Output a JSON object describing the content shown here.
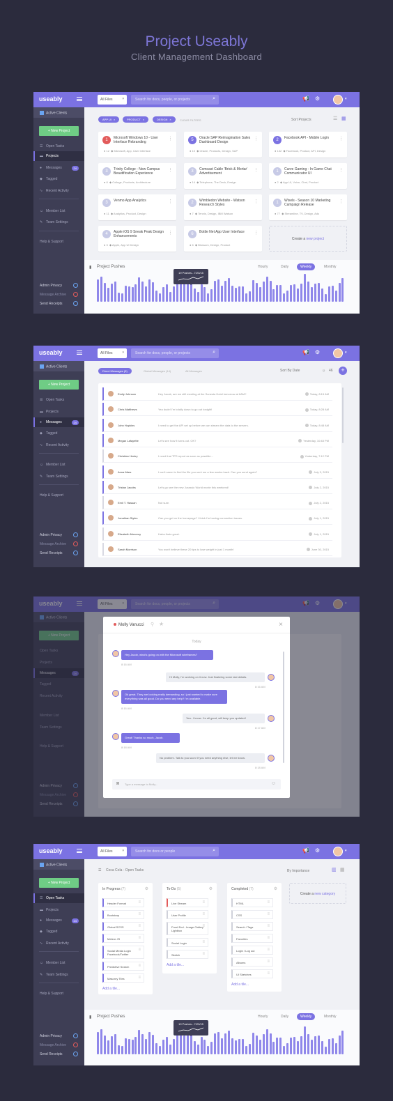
{
  "hero": {
    "title": "Project Useably",
    "subtitle": "Client Management Dashboard"
  },
  "common": {
    "logo": "useably",
    "file_select": "All Files",
    "search_placeholder": "Search for docs, people, or projects",
    "search_placeholder_short": "Search for docs or people",
    "active_clients": "Active Clients",
    "new_project": "+ New Project",
    "nav": {
      "open_tasks": "Open Tasks",
      "projects": "Projects",
      "messages": "Messages",
      "messages_badge": "24",
      "tagged": "Tagged",
      "recent_activity": "Recent Activity",
      "member_list": "Member List",
      "team_settings": "Team Settings",
      "help": "Help & Support"
    },
    "toggles": {
      "admin_privacy": "Admin Privacy",
      "message_archive": "Message Archive",
      "send_receipts": "Send Receipts"
    }
  },
  "projects": {
    "filters": [
      "APP UI",
      "PRODUCT",
      "DESIGN"
    ],
    "clear_filters": "CLEAR FILTERS",
    "sort": "Sort Projects",
    "cards": [
      {
        "num": "1",
        "color": "#e25b5b",
        "title": "Microsoft Windows 10 - User Interface Rebranding",
        "comments": "12",
        "tags": "Microsoft, App, User Interface"
      },
      {
        "num": "5",
        "color": "#7b72e2",
        "title": "Oracle SAP Reimagination Sales Dashboard Design",
        "comments": "10",
        "tags": "Oracle, Products, Design, SAP"
      },
      {
        "num": "2",
        "color": "#7b72e2",
        "title": "Facebook API - Mobile Login",
        "comments": "132",
        "tags": "Facebook, Product, API, Design"
      },
      {
        "num": "3",
        "color": "#c7cae6",
        "title": "Trinity College - New Campus Beautification Experience",
        "comments": "8",
        "tags": "College, Products, Architecture"
      },
      {
        "num": "3",
        "color": "#c7cae6",
        "title": "Comcast Cable 'Brick & Mortar' Advertisement",
        "comments": "14",
        "tags": "Telephone, The Deck, Design"
      },
      {
        "num": "1",
        "color": "#c7cae6",
        "title": "Curve Gaming - In Game Chat Communicator UI",
        "comments": "2",
        "tags": "App UI, Voice, Chat, Product"
      },
      {
        "num": "3",
        "color": "#c7cae6",
        "title": "Venmo App Analytics",
        "comments": "11",
        "tags": "Analytics, Product, Design"
      },
      {
        "num": "2",
        "color": "#c7cae6",
        "title": "Wimbledon Website - Watson Research Styles",
        "comments": "7",
        "tags": "Tennis, Design, IBM Watson"
      },
      {
        "num": "1",
        "color": "#c7cae6",
        "title": "Wixels - Season 10 Marketing Campaign Release",
        "comments": "77",
        "tags": "Streamline, TV, Design, Ads"
      },
      {
        "num": "4",
        "color": "#c7cae6",
        "title": "Apple iOS 9 Sneak Peak Design Enhancements",
        "comments": "3",
        "tags": "Apple, App UI Design"
      },
      {
        "num": "6",
        "color": "#c7cae6",
        "title": "Bottle Net App User Interface",
        "comments": "6",
        "tags": "Blossom, Design, Product"
      }
    ],
    "add_card": {
      "prefix": "Create a",
      "link": "new project"
    }
  },
  "pushes": {
    "title": "Project Pushes",
    "ranges": [
      "Hourly",
      "Daily",
      "Weekly",
      "Monthly"
    ],
    "selected": "Weekly",
    "tooltip": "19 Pushes - 7/23/15"
  },
  "messages": {
    "tabs": [
      "Direct Messages (8)",
      "Global Messages (14)",
      "All Messages"
    ],
    "sort": "Sort By Date",
    "count": "46",
    "rows": [
      {
        "name": "Emily Johnson",
        "text": "Hey Jacob, are we still meeting at the Sonesta Hotel tomorrow at 6AM?",
        "date": "Today, 8:15 AM",
        "unread": true
      },
      {
        "name": "Chris Matthews",
        "text": "Yea dude! I'm totally down to go out tonight!",
        "date": "Today, 8:28 AM",
        "unread": true
      },
      {
        "name": "John Hopkins",
        "text": "I need to get the API set up before we can stream the data to the servers.",
        "date": "Today, 8:48 AM",
        "unread": true
      },
      {
        "name": "Megan Lafayette",
        "text": "Let's see how it turns out. OK?",
        "date": "Yesterday, 10:48 PM",
        "unread": true
      },
      {
        "name": "Christian Hentry",
        "text": "I need that TPS report as soon as possible...",
        "date": "Yesterday, 7:12 PM",
        "unread": false
      },
      {
        "name": "Anna Mars",
        "text": "I can't seem to find the file you sent me a few weeks back. Can you send again?",
        "date": "July 3, 2015",
        "unread": true
      },
      {
        "name": "Tristan Jacobs",
        "text": "Let's go see the new Jurassic World movie this weekend!",
        "date": "July 2, 2015",
        "unread": true
      },
      {
        "name": "Emil T. Hassan",
        "text": "Not sure.",
        "date": "July 2, 2015",
        "unread": false
      },
      {
        "name": "Jonathan Styles",
        "text": "Can you get on the homepage? I think I'm having connection issues.",
        "date": "July 1, 2015",
        "unread": true
      },
      {
        "name": "Elizabeth Moneroy",
        "text": "Haha thats great.",
        "date": "July 1, 2015",
        "unread": false
      },
      {
        "name": "Sarah Morrison",
        "text": "You won't believe these 20 tips to lose weight in just 1 month!",
        "date": "June 30, 2015",
        "unread": false
      }
    ]
  },
  "chat": {
    "name": "Molly Vanucci",
    "today": "Today",
    "bubbles": [
      {
        "side": "in",
        "text": "Hey Jacob, what's going on with the Microsoft wireframes?",
        "time": "8:16 AM"
      },
      {
        "side": "out",
        "text": "Hi Molly, I'm working on it now. Just finalizing some last details.",
        "time": "8:16 AM"
      },
      {
        "side": "in",
        "text": "Ok great. They are looking really demanding, so I just wanted to make sure everything was all good. Do you need any help? I'm available.",
        "time": "8:16 AM"
      },
      {
        "side": "out",
        "text": "Yea.. I know. I'm all good, will keep you updated!",
        "time": "8:17 AM"
      },
      {
        "side": "in",
        "text": "Great! Thanks so much, Jacob.",
        "time": "8:18 AM"
      },
      {
        "side": "out",
        "text": "No problem. Talk to you soon! If you need anything else, let me know.",
        "time": "8:18 AM"
      }
    ],
    "compose": "Type a message to Molly..."
  },
  "board": {
    "crumb": "Coca Cola - Open Tasks",
    "sort": "By Importance",
    "columns": [
      {
        "title": "In Progress",
        "count": "(7)",
        "tiles": [
          "Header Format",
          "Bootstrap",
          "Global SCSS",
          "Meteor JS",
          "Social Media Login Facebook/Twitter",
          "Predictive Search",
          "Masonry Tiles"
        ]
      },
      {
        "title": "To-Do",
        "count": "(5)",
        "tiles": [
          "Live Stream",
          "User Profile",
          "Front End - Image Gallery Lightbox",
          "Social Login",
          "Sketch"
        ]
      },
      {
        "title": "Completed",
        "count": "(7)",
        "tiles": [
          "HTML",
          "CSS",
          "Search / Tags",
          "Favorites",
          "Login / Log out",
          "Albums",
          "UI Sketches"
        ]
      }
    ],
    "add_tile": "Add a tile...",
    "add_category": {
      "prefix": "Create a",
      "link": "new category"
    }
  }
}
